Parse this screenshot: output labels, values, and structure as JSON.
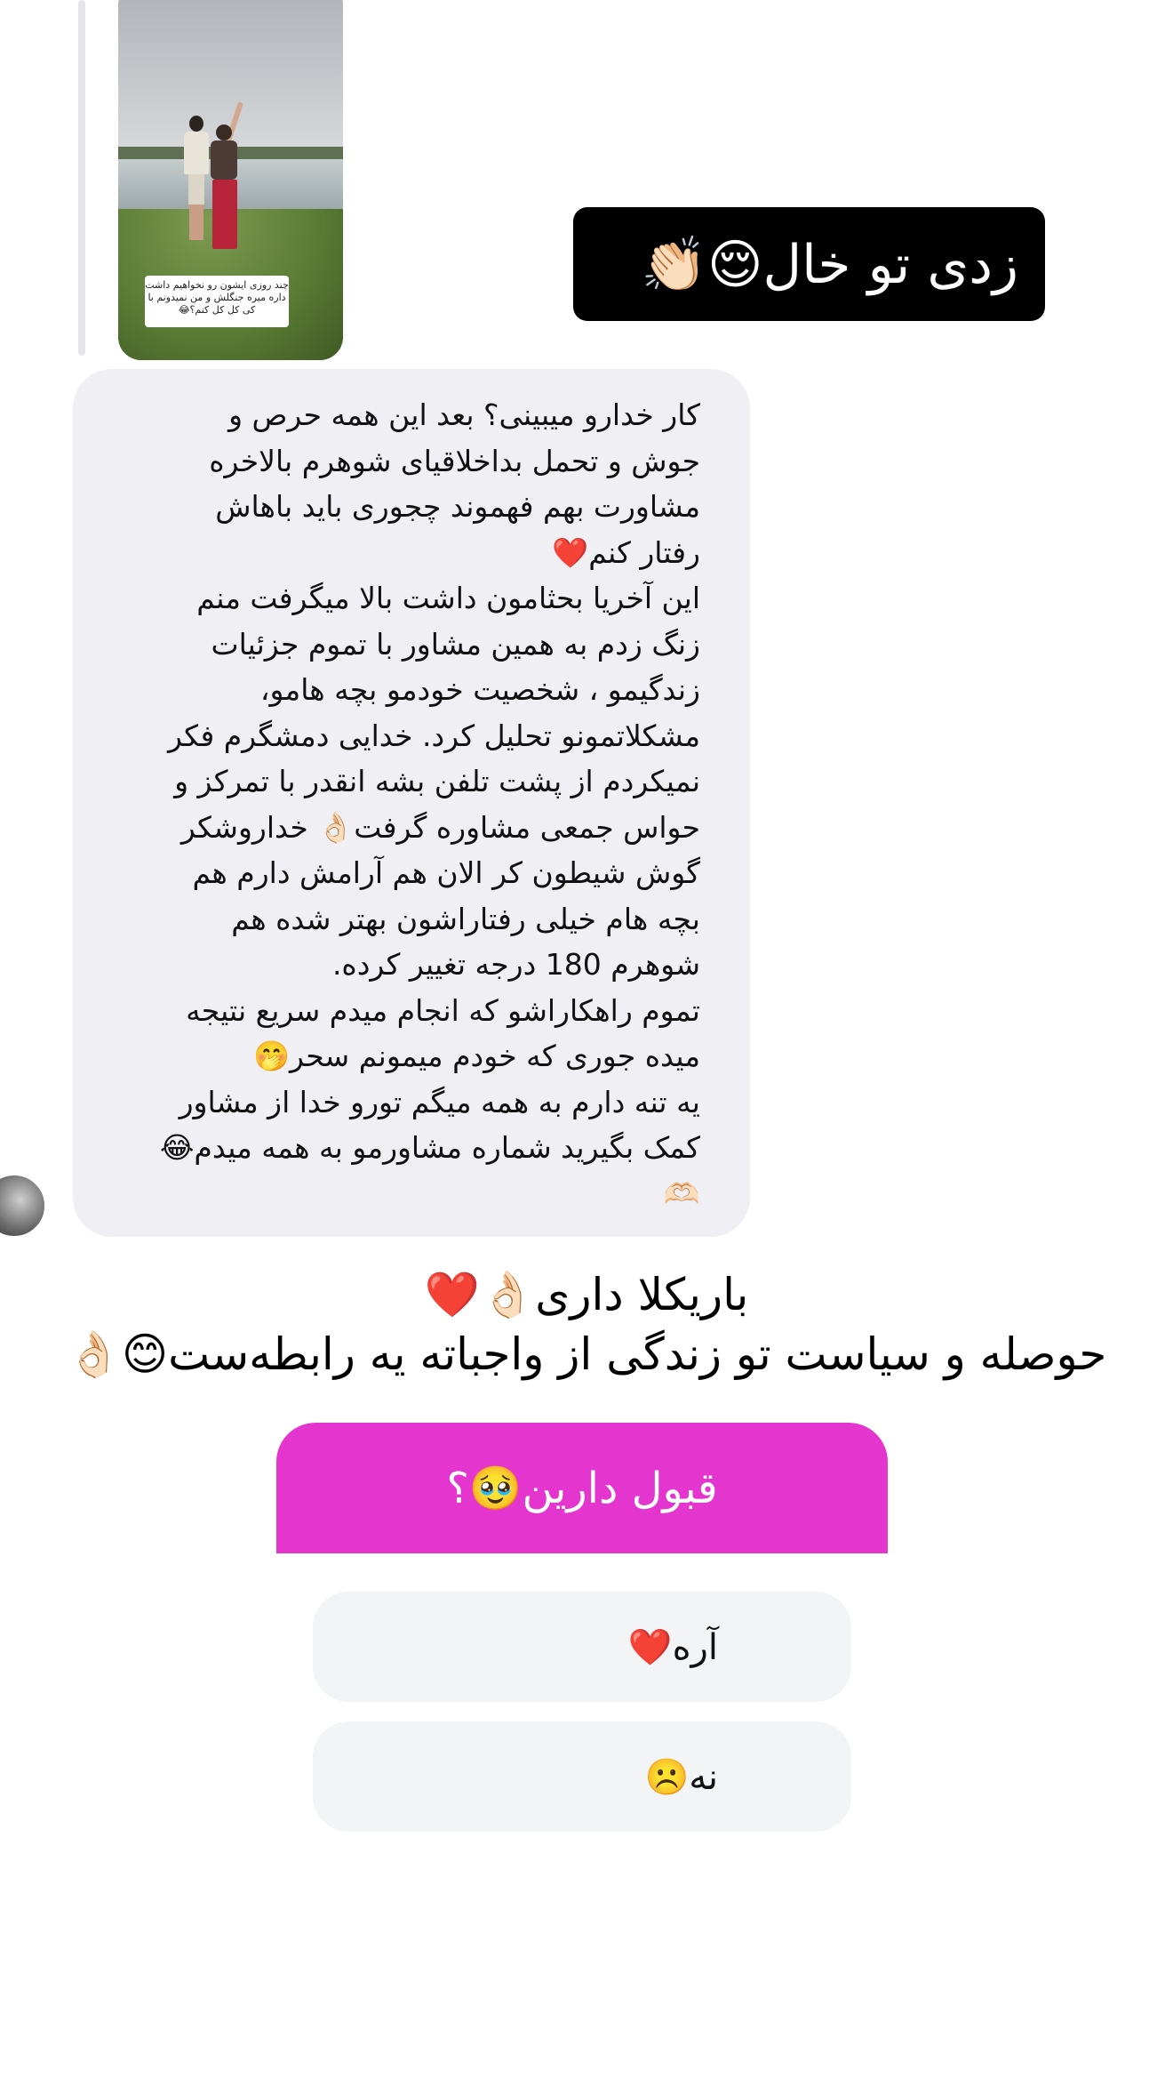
{
  "story_reply": {
    "thumbnail_caption": "چند روزی ایشون رو نخواهیم داشت\nداره میره جنگلش و من نمیدونم با\nکی کل کل کنم؟😂"
  },
  "sticker": {
    "text": "زدی تو خال😌👏🏻"
  },
  "message": {
    "text": "کار خدارو میبینی؟ بعد این همه حرص و\nجوش و تحمل بداخلاقیای شوهرم بالاخره\nمشاورت بهم فهموند چجوری باید باهاش\nرفتار کنم❤️\nاین آخریا بحثامون داشت بالا میگرفت منم\nزنگ زدم به همین مشاور با تموم جزئیات\nزندگیمو ، شخصیت خودمو بچه هامو،\nمشکلاتمونو تحلیل کرد. خدایی دمشگرم فکر\nنمیکردم از پشت تلفن بشه انقدر با تمرکز و\nحواس جمعی مشاوره گرفت👌🏻 خداروشکر\nگوش شیطون کر الان هم آرامش دارم هم\nبچه هام خیلی رفتاراشون بهتر شده هم\nشوهرم 180 درجه تغییر کرده.\nتموم راهکاراشو که انجام میدم سریع نتیجه\nمیده جوری که خودم میمونم سحر🤭\nیه تنه دارم به همه میگم تورو خدا از مشاور\nکمک بگیرید شماره مشاورمو به همه میدم😂\n🫶🏻"
  },
  "caption": {
    "line1": "باریکلا داری👌🏻❤️",
    "line2": "حوصله و سیاست تو زندگی از واجباته یه رابطه‌ست😊👌🏻"
  },
  "poll": {
    "question": "قبول دارین🥹؟",
    "options": [
      {
        "label": "آره❤️"
      },
      {
        "label": "نه☹️"
      }
    ]
  }
}
